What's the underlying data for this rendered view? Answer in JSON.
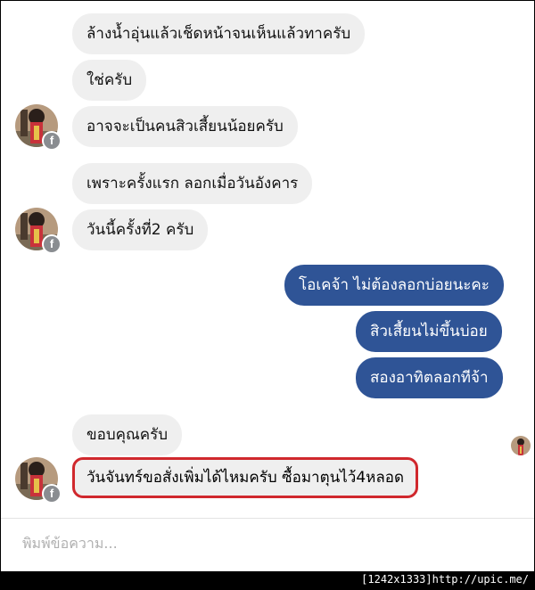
{
  "messages": [
    {
      "text": "ล้างน้ำอุ่นแล้วเช็ดหน้าจนเห็นแล้วทาครับ",
      "from": "them"
    },
    {
      "text": "ใช่ครับ",
      "from": "them"
    },
    {
      "text": "อาจจะเป็นคนสิวเสี้ยนน้อยครับ",
      "from": "them"
    },
    {
      "text": "เพราะครั้งแรก ลอกเมื่อวันอังคาร",
      "from": "them"
    },
    {
      "text": "วันนี้ครั้งที่2 ครับ",
      "from": "them"
    },
    {
      "text": "โอเคจ้า ไม่ต้องลอกบ่อยนะคะ",
      "from": "me"
    },
    {
      "text": "สิวเสี้ยนไม่ขึ้นบ่อย",
      "from": "me"
    },
    {
      "text": "สองอาทิตลอกทีจ้า",
      "from": "me"
    },
    {
      "text": "ขอบคุณครับ",
      "from": "them"
    },
    {
      "text": "วันจันทร์ขอสั่งเพิ่มได้ไหมครับ ซื้อมาตุนไว้4หลอด",
      "from": "them",
      "highlighted": true
    }
  ],
  "composer": {
    "placeholder": "พิมพ์ข้อความ..."
  },
  "badge": {
    "glyph": "f"
  },
  "watermark": {
    "text": "[1242x1333]http://upic.me/"
  },
  "colors": {
    "incoming_bubble": "#efefef",
    "outgoing_bubble": "#2f5496",
    "highlight_border": "#d0282d"
  }
}
